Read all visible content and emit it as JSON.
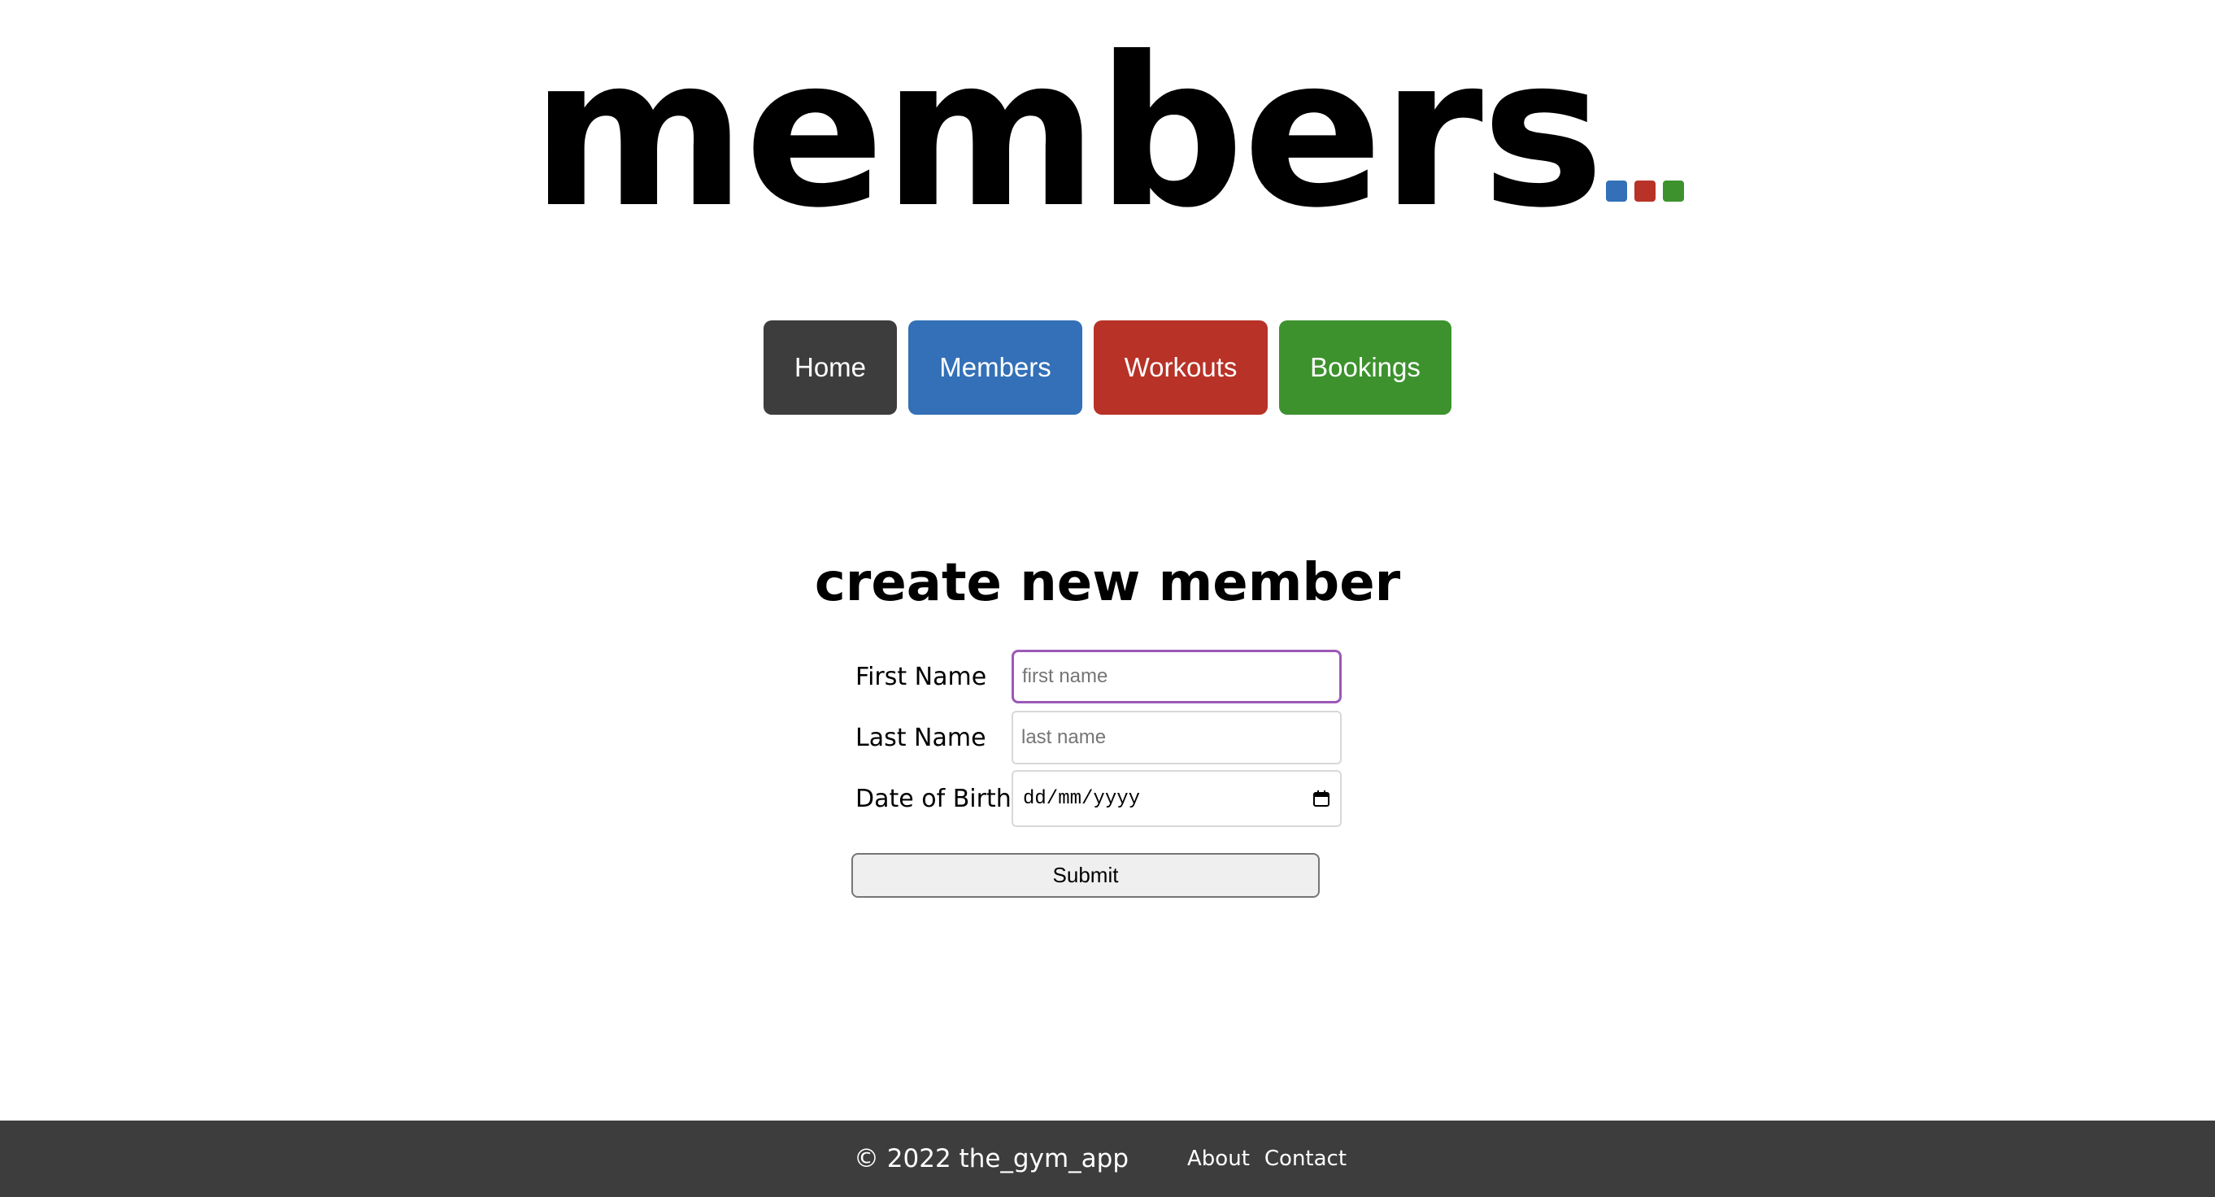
{
  "logo": {
    "text": "members",
    "dot_colors": [
      "#3370b7",
      "#b83227",
      "#3d922e"
    ]
  },
  "nav": {
    "items": [
      {
        "label": "Home",
        "color": "#3d3d3d"
      },
      {
        "label": "Members",
        "color": "#3370b7"
      },
      {
        "label": "Workouts",
        "color": "#b83227"
      },
      {
        "label": "Bookings",
        "color": "#3d922e"
      }
    ]
  },
  "form": {
    "heading": "create new member",
    "first_name": {
      "label": "First Name",
      "placeholder": "first name",
      "value": ""
    },
    "last_name": {
      "label": "Last Name",
      "placeholder": "last name",
      "value": ""
    },
    "dob": {
      "label": "Date of Birth",
      "display": "dd/mm/yyyy",
      "icon": "calendar-icon"
    },
    "submit_label": "Submit",
    "focus_color": "#9b59b6"
  },
  "footer": {
    "copyright": "© 2022 the_gym_app",
    "links": [
      "About",
      "Contact"
    ],
    "background": "#3d3d3d"
  }
}
